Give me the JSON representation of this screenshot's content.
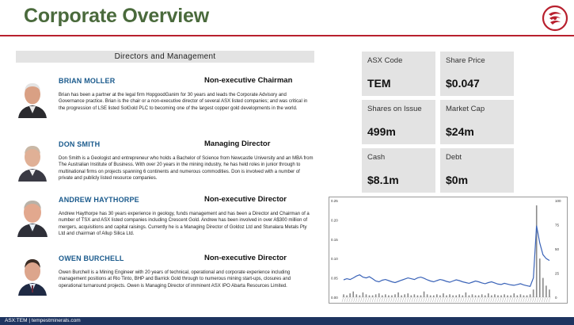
{
  "header": {
    "title": "Corporate Overview"
  },
  "section": {
    "heading": "Directors and Management"
  },
  "directors": [
    {
      "name": "BRIAN MOLLER",
      "role": "Non-executive Chairman",
      "bio": "Brian has been a partner at the legal firm HopgoodGanim for 30 years and leads the Corporate Advisory and Governance practice. Brian is the chair or a non-executive director of several ASX listed companies; and was critical in the progression of LSE listed SolGold PLC to becoming one of the largest copper gold developments in the world."
    },
    {
      "name": "DON SMITH",
      "role": "Managing Director",
      "bio": "Don Smith is a Geologist and entrepreneur who holds a Bachelor of Science from Newcastle University and an MBA from The Australian Institute of Business. With over 20 years in the mining industry, he has held roles in junior through to multinational firms on projects spanning 6 continents and numerous commodities. Don is involved with a number of private and publicly listed resource companies."
    },
    {
      "name": "ANDREW HAYTHORPE",
      "role": "Non-executive Director",
      "bio": "Andrew Haythorpe has 30 years experience in geology, funds management and has been a Director and Chairman of a number of TSX and ASX listed companies including Crescent Gold. Andrew has been involved in over A$300 million of mergers, acquisitions and capital raisings.  Currently he is a Managing Director of Goldoz Ltd and Stunalara Metals Pty Ltd and chairman of Allup Silica Ltd."
    },
    {
      "name": "OWEN BURCHELL",
      "role": "Non-executive Director",
      "bio": "Owen Burchell is a Mining Engineer with 20 years of technical, operational and corporate experience including management positions at Rio Tinto, BHP and Barrick Gold through to numerous mining start-ups, closures and operational turnaround projects. Owen is Managing Director of imminent ASX IPO Abarta Resources Limited."
    }
  ],
  "stats": [
    {
      "label": "ASX Code",
      "value": "TEM"
    },
    {
      "label": "Share Price",
      "value": "$0.047"
    },
    {
      "label": "Shares on Issue",
      "value": "499m"
    },
    {
      "label": "Market Cap",
      "value": "$24m"
    },
    {
      "label": "Cash",
      "value": "$8.1m"
    },
    {
      "label": "Debt",
      "value": "$0m"
    }
  ],
  "chart_data": {
    "type": "line",
    "left_axis": {
      "ticks": [
        "0.25",
        "0.20",
        "0.15",
        "0.10",
        "0.05",
        "0.00"
      ],
      "range": [
        0,
        0.25
      ]
    },
    "right_axis": {
      "ticks": [
        "100",
        "75",
        "50",
        "25",
        "0"
      ],
      "range": [
        0,
        100
      ]
    },
    "series": [
      {
        "axis": "left",
        "style": "line",
        "color": "#3a63b8",
        "values": [
          0.045,
          0.048,
          0.046,
          0.05,
          0.055,
          0.058,
          0.052,
          0.05,
          0.053,
          0.048,
          0.042,
          0.04,
          0.044,
          0.046,
          0.043,
          0.04,
          0.038,
          0.041,
          0.044,
          0.047,
          0.05,
          0.048,
          0.046,
          0.05,
          0.052,
          0.049,
          0.045,
          0.042,
          0.04,
          0.043,
          0.046,
          0.044,
          0.041,
          0.039,
          0.042,
          0.045,
          0.043,
          0.04,
          0.038,
          0.036,
          0.039,
          0.042,
          0.04,
          0.037,
          0.035,
          0.038,
          0.04,
          0.037,
          0.034,
          0.033,
          0.036,
          0.034,
          0.032,
          0.031,
          0.033,
          0.035,
          0.032,
          0.03,
          0.028,
          0.05,
          0.185,
          0.14,
          0.11,
          0.1,
          0.095
        ]
      },
      {
        "axis": "right",
        "style": "bars",
        "color": "#8a8a8a",
        "values": [
          3,
          2,
          4,
          6,
          3,
          2,
          5,
          3,
          2,
          2,
          3,
          4,
          2,
          3,
          2,
          2,
          3,
          5,
          2,
          3,
          4,
          2,
          3,
          2,
          2,
          6,
          3,
          2,
          2,
          3,
          2,
          4,
          2,
          3,
          2,
          2,
          3,
          2,
          5,
          2,
          3,
          2,
          2,
          3,
          2,
          4,
          2,
          3,
          2,
          2,
          3,
          2,
          2,
          4,
          2,
          3,
          2,
          2,
          3,
          8,
          95,
          40,
          20,
          12,
          8
        ]
      }
    ]
  },
  "footer": {
    "text": "ASX:TEM | tempestminerals.com"
  },
  "colors": {
    "title": "#4a6a3c",
    "rule": "#b8202e",
    "name": "#1a5a8c",
    "tile": "#e3e3e3",
    "footer": "#1e3460",
    "line": "#3a63b8"
  }
}
